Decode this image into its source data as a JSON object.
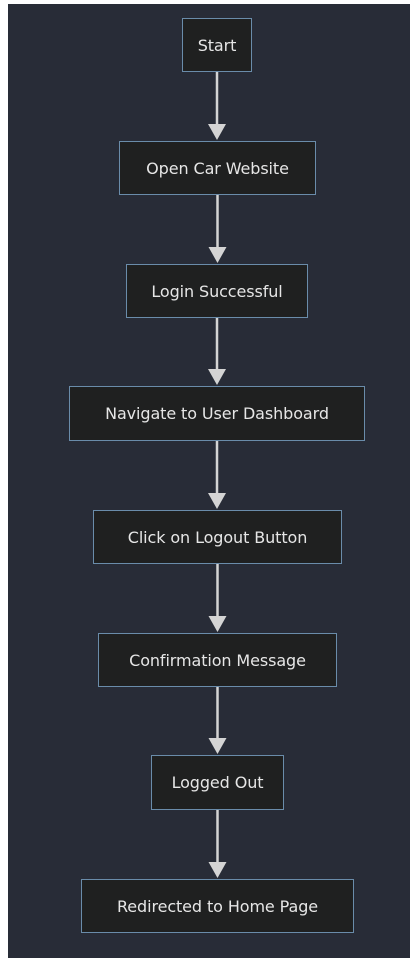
{
  "diagram": {
    "type": "flowchart",
    "direction": "top-to-bottom",
    "colors": {
      "background": "#282c37",
      "node_fill": "#1f2020",
      "node_border": "#6a8caa",
      "node_text": "#e6e6e6",
      "edge": "#d4d4d4"
    },
    "nodes": [
      {
        "id": "n1",
        "label": "Start"
      },
      {
        "id": "n2",
        "label": "Open Car Website"
      },
      {
        "id": "n3",
        "label": "Login Successful"
      },
      {
        "id": "n4",
        "label": "Navigate to User Dashboard"
      },
      {
        "id": "n5",
        "label": "Click on Logout Button"
      },
      {
        "id": "n6",
        "label": "Confirmation Message"
      },
      {
        "id": "n7",
        "label": "Logged Out"
      },
      {
        "id": "n8",
        "label": "Redirected to Home Page"
      }
    ],
    "edges": [
      {
        "from": "n1",
        "to": "n2"
      },
      {
        "from": "n2",
        "to": "n3"
      },
      {
        "from": "n3",
        "to": "n4"
      },
      {
        "from": "n4",
        "to": "n5"
      },
      {
        "from": "n5",
        "to": "n6"
      },
      {
        "from": "n6",
        "to": "n7"
      },
      {
        "from": "n7",
        "to": "n8"
      }
    ]
  }
}
